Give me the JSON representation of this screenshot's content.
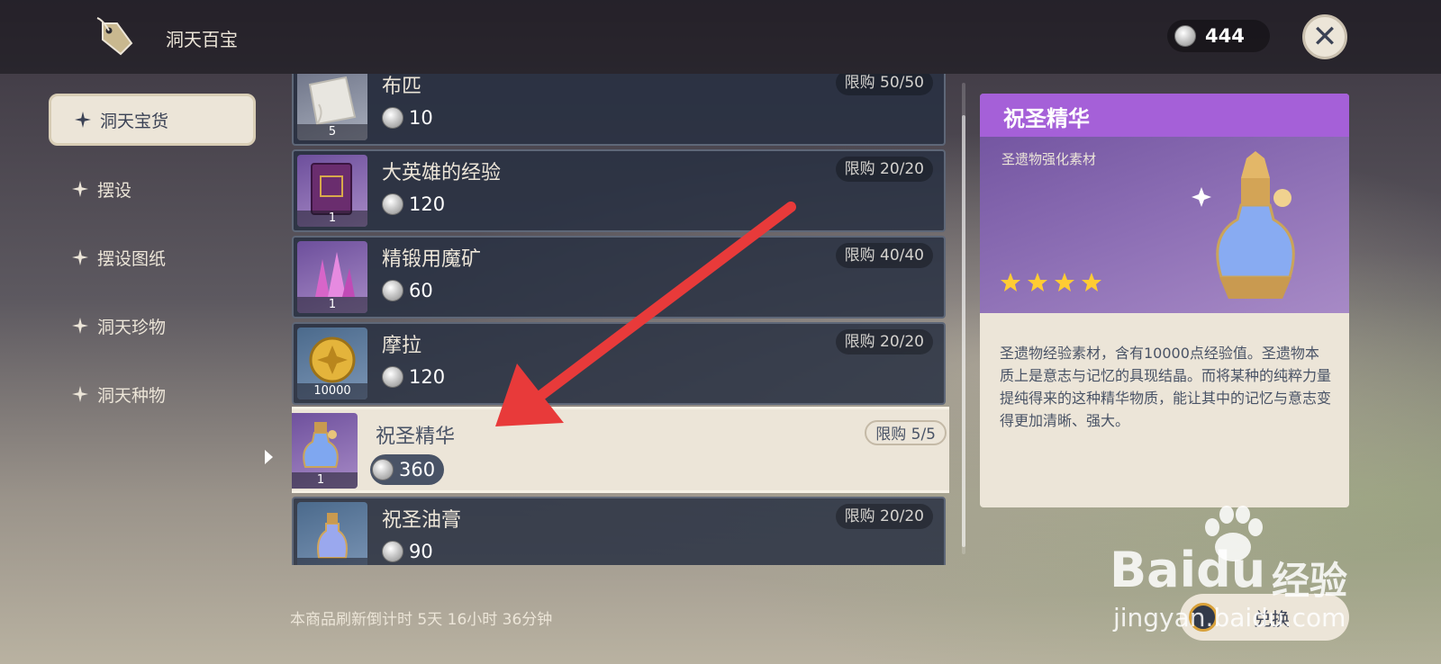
{
  "header": {
    "title": "洞天百宝",
    "currency_amount": "444",
    "close_icon": "close-icon"
  },
  "sidebar": {
    "items": [
      {
        "label": "洞天宝货",
        "active": true
      },
      {
        "label": "摆设",
        "active": false
      },
      {
        "label": "摆设图纸",
        "active": false
      },
      {
        "label": "洞天珍物",
        "active": false
      },
      {
        "label": "洞天种物",
        "active": false
      }
    ]
  },
  "items": [
    {
      "name": "布匹",
      "price": "10",
      "limit": "限购 50/50",
      "qty": "5"
    },
    {
      "name": "大英雄的经验",
      "price": "120",
      "limit": "限购 20/20",
      "qty": "1"
    },
    {
      "name": "精锻用魔矿",
      "price": "60",
      "limit": "限购 40/40",
      "qty": "1"
    },
    {
      "name": "摩拉",
      "price": "120",
      "limit": "限购 20/20",
      "qty": "10000"
    },
    {
      "name": "祝圣精华",
      "price": "360",
      "limit": "限购 5/5",
      "qty": "1",
      "selected": true
    },
    {
      "name": "祝圣油膏",
      "price": "90",
      "limit": "限购 20/20",
      "qty": ""
    }
  ],
  "detail": {
    "title": "祝圣精华",
    "subtitle": "圣遗物强化素材",
    "rarity": 4,
    "description": "圣遗物经验素材，含有10000点经验值。圣遗物本质上是意志与记忆的具现结晶。而将某种的纯粹力量提纯得来的这种精华物质，能让其中的记忆与意志变得更加清晰、强大。",
    "title_color": "#a560d8"
  },
  "footer": {
    "refresh_text": "本商品刷新倒计时 5天 16小时 36分钟",
    "exchange_label": "兑换"
  },
  "watermark": {
    "brand": "Bai",
    "brand2": "du",
    "brand_cn": "经验",
    "url": "jingyan.baidu.com"
  },
  "annotation": {
    "arrow_color": "#e83a3a"
  }
}
